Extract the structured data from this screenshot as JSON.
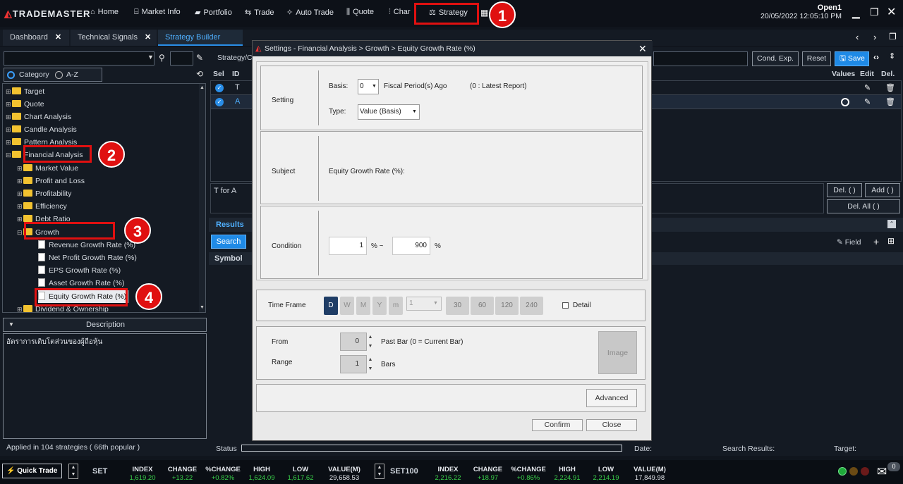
{
  "app": {
    "logo": "TRADEMASTER",
    "user": "Open1",
    "datetime": "20/05/2022 12:05:10 PM"
  },
  "nav": [
    {
      "label": "Home",
      "icon": "home-icon"
    },
    {
      "label": "Market Info",
      "icon": "bank-icon"
    },
    {
      "label": "Portfolio",
      "icon": "briefcase-icon"
    },
    {
      "label": "Trade",
      "icon": "trade-arrows-icon"
    },
    {
      "label": "Auto Trade",
      "icon": "wand-icon"
    },
    {
      "label": "Quote",
      "icon": "candle-icon"
    },
    {
      "label": "Char",
      "icon": "chart-icon"
    },
    {
      "label": "Strategy",
      "icon": "strategy-icon"
    }
  ],
  "tabs": [
    {
      "label": "Dashboard"
    },
    {
      "label": "Technical Signals"
    },
    {
      "label": "Strategy Builder",
      "active": true
    }
  ],
  "left": {
    "filter_category": "Category",
    "filter_az": "A-Z",
    "tree": [
      {
        "label": "Target"
      },
      {
        "label": "Quote"
      },
      {
        "label": "Chart Analysis"
      },
      {
        "label": "Candle Analysis"
      },
      {
        "label": "Pattern Analysis"
      },
      {
        "label": "Financial Analysis"
      },
      {
        "label": "Market Value"
      },
      {
        "label": "Profit and Loss"
      },
      {
        "label": "Profitability"
      },
      {
        "label": "Efficiency"
      },
      {
        "label": "Debt Ratio"
      },
      {
        "label": "Growth"
      },
      {
        "label": "Revenue Growth Rate (%)"
      },
      {
        "label": "Net Profit Growth Rate (%)"
      },
      {
        "label": "EPS Growth Rate (%)"
      },
      {
        "label": "Asset Growth Rate (%)"
      },
      {
        "label": "Equity Growth Rate (%)"
      },
      {
        "label": "Dividend & Ownership"
      }
    ],
    "description_header": "Description",
    "description_text": "อัตราการเติบโตส่วนของผู้ถือหุ้น",
    "applied": "Applied in 104 strategies ( 66th popular )"
  },
  "right": {
    "strategy_label": "Strategy/C",
    "cond_exp": "Cond. Exp.",
    "reset": "Reset",
    "save": "Save",
    "cols": {
      "sel": "Sel",
      "id": "ID",
      "values": "Values",
      "edit": "Edit",
      "del": "Del."
    },
    "rows": [
      {
        "id": "T"
      },
      {
        "id": "A"
      }
    ],
    "expr_text": "T for A",
    "del_btn": "Del. ( )",
    "add_btn": "Add ( )",
    "del_all_btn": "Del. All ( )",
    "results_tab": "Results",
    "search_btn": "Search",
    "symbol_header": "Symbol",
    "field_label": "Field"
  },
  "dialog": {
    "title": "Settings - Financial Analysis > Growth > Equity Growth Rate (%)",
    "setting_label": "Setting",
    "basis_label": "Basis:",
    "basis_value": "0",
    "fiscal_text": "Fiscal Period(s) Ago",
    "latest_text": "(0 : Latest Report)",
    "type_label": "Type:",
    "type_value": "Value (Basis)",
    "subject_label": "Subject",
    "subject_value": "Equity Growth Rate (%):",
    "condition_label": "Condition",
    "cond_min": "1",
    "cond_mid": "% ~",
    "cond_max": "900",
    "cond_unit": "%",
    "timeframe_label": "Time Frame",
    "tf_buttons": [
      "D",
      "W",
      "M",
      "Y",
      "m"
    ],
    "tf_select": "1",
    "tf_nums": [
      "30",
      "60",
      "120",
      "240"
    ],
    "detail_label": "Detail",
    "from_label": "From",
    "from_value": "0",
    "past_bar_text": "Past Bar (0 = Current Bar)",
    "range_label": "Range",
    "range_value": "1",
    "bars_text": "Bars",
    "image_btn": "Image",
    "advanced_btn": "Advanced",
    "confirm_btn": "Confirm",
    "close_btn": "Close"
  },
  "status": {
    "status_label": "Status",
    "date_label": "Date:",
    "search_results_label": "Search Results:",
    "target_label": "Target:"
  },
  "ticker": {
    "quick_trade": "Quick Trade",
    "markets": [
      {
        "name": "SET",
        "index": "1,619.20",
        "change": "+13.22",
        "pchange": "+0.82%",
        "high": "1,624.09",
        "low": "1,617.62",
        "value": "29,658.53"
      },
      {
        "name": "SET100",
        "index": "2,216.22",
        "change": "+18.97",
        "pchange": "+0.86%",
        "high": "2,224.91",
        "low": "2,214.19",
        "value": "17,849.98"
      }
    ],
    "headers": {
      "index": "INDEX",
      "change": "CHANGE",
      "pchange": "%CHANGE",
      "high": "HIGH",
      "low": "LOW",
      "value": "VALUE(M)"
    },
    "notifications": "0"
  },
  "annotations": [
    "1",
    "2",
    "3",
    "4"
  ],
  "colors": {
    "accent": "#2a8ee8",
    "highlight": "#e01010",
    "up": "#3ad14a",
    "folder": "#f2c230"
  }
}
